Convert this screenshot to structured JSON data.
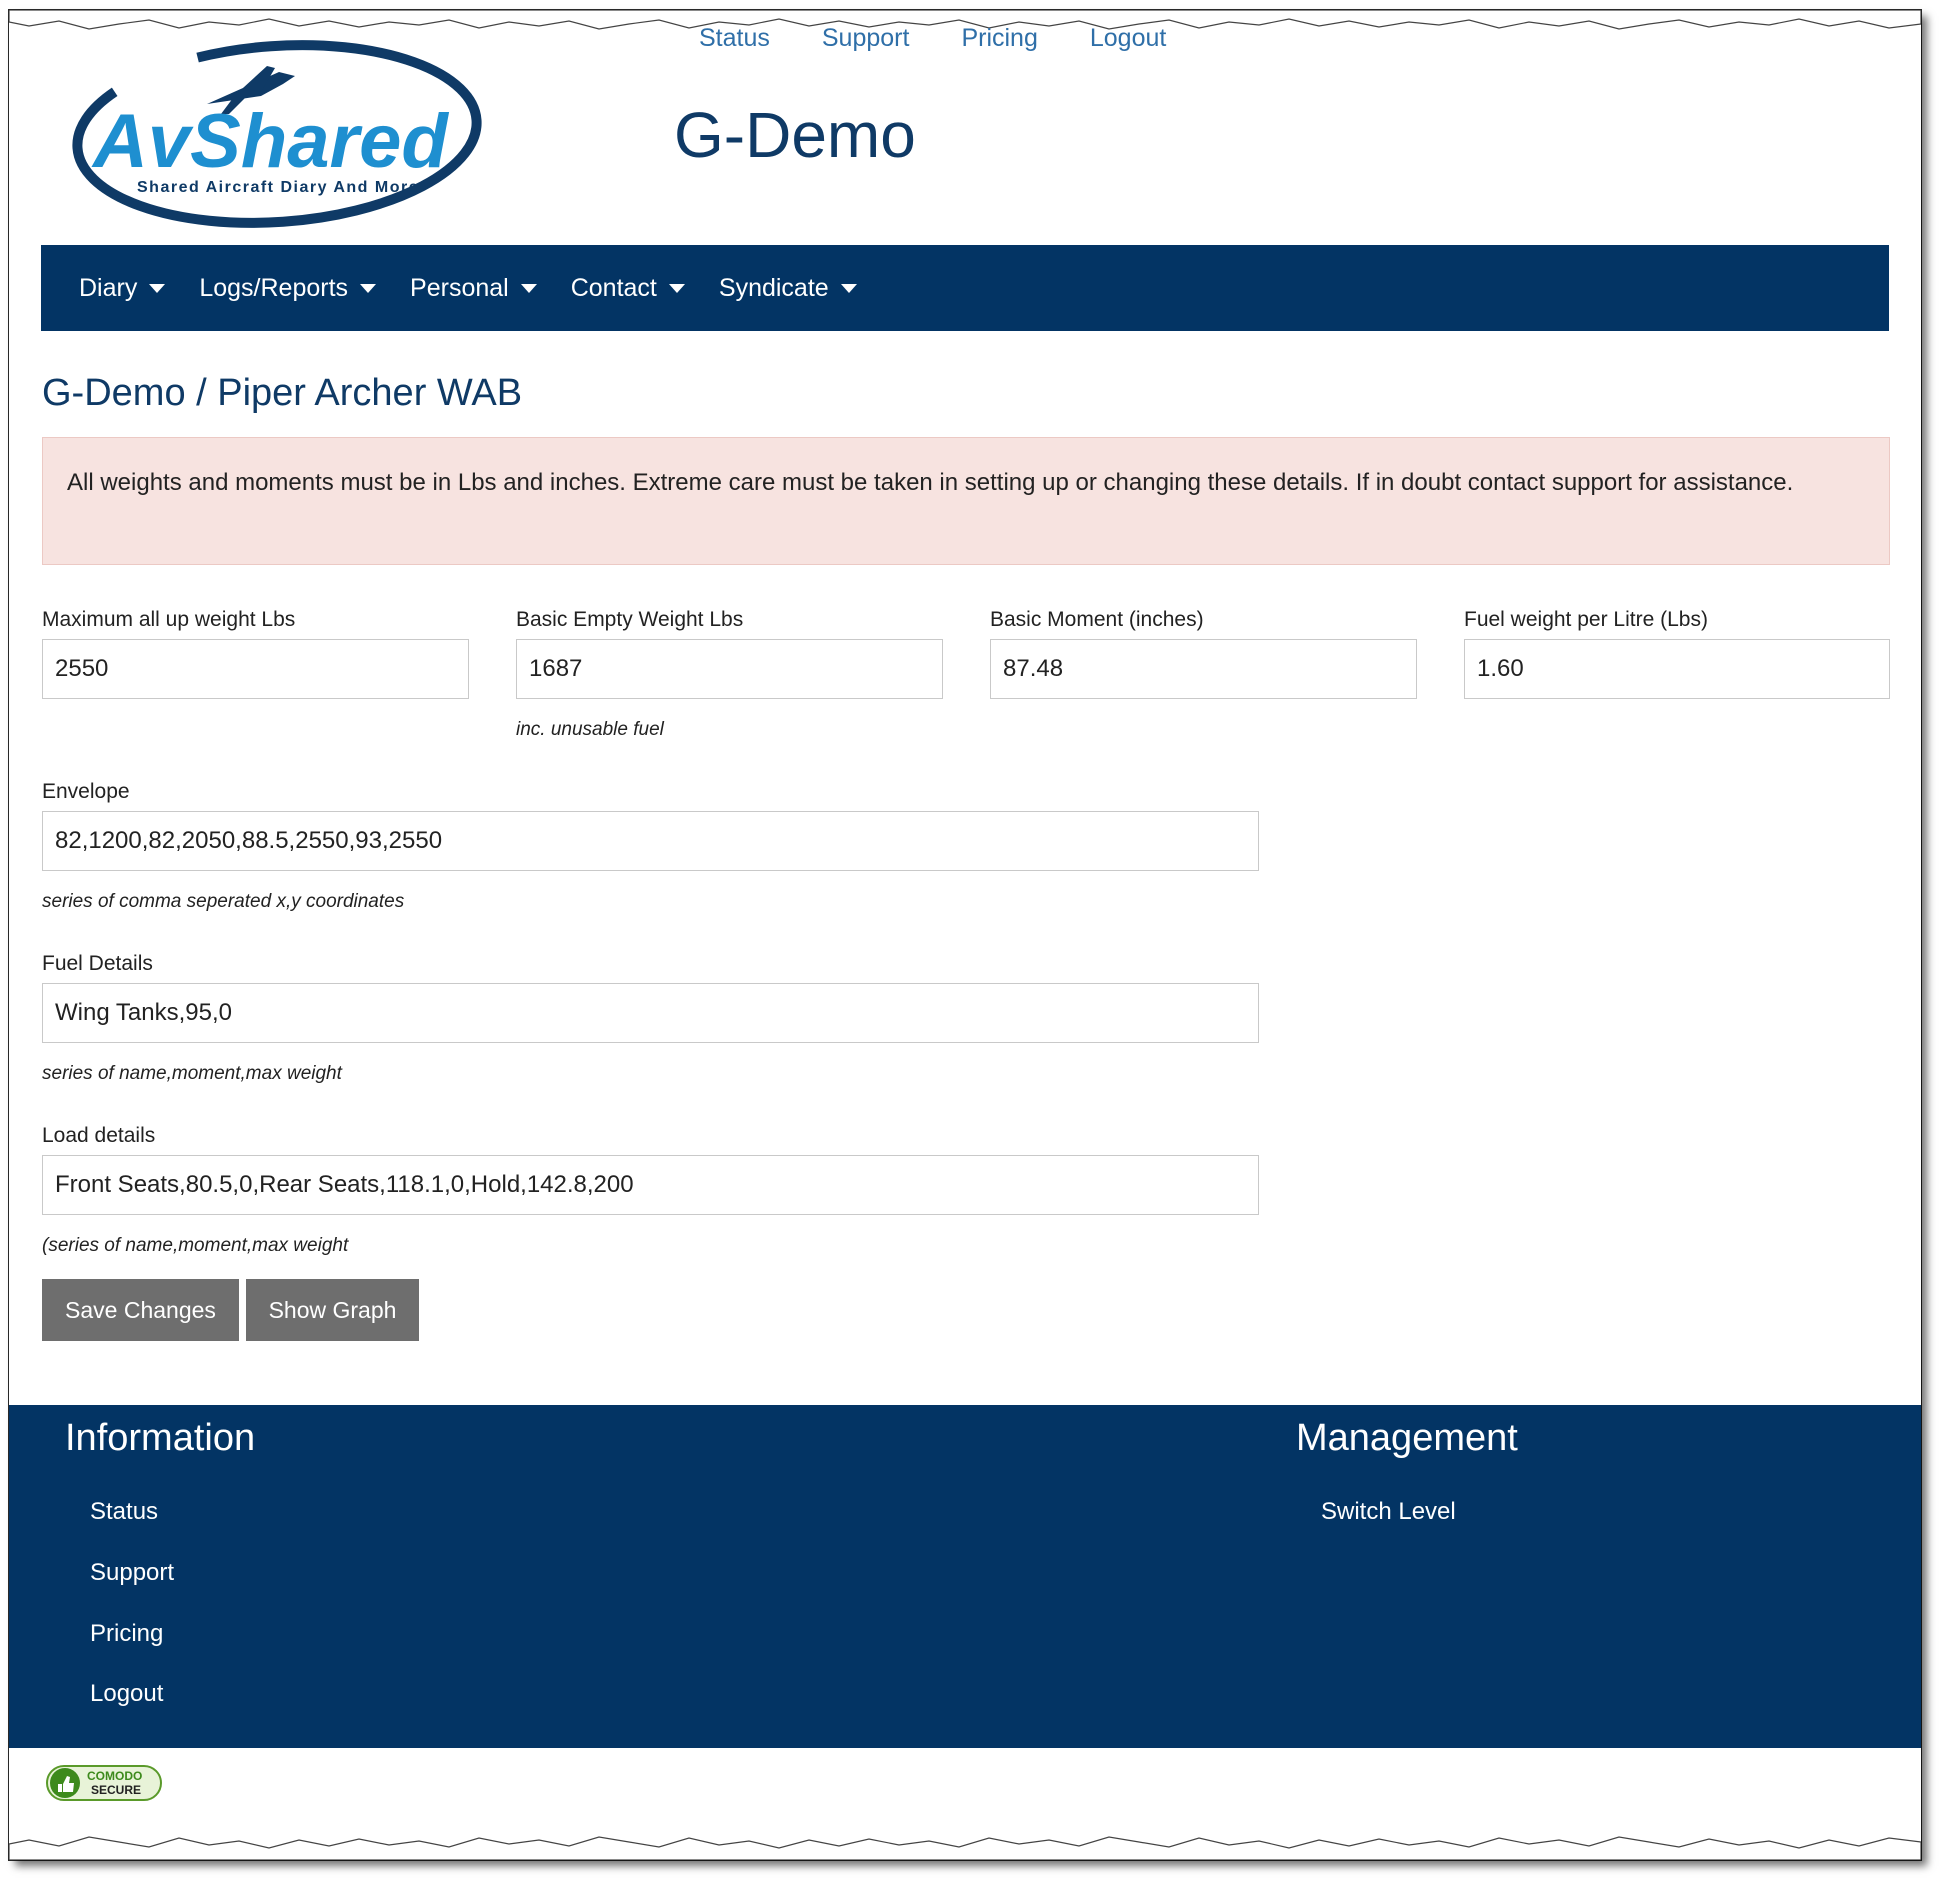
{
  "top_nav": {
    "links": [
      "Status",
      "Support",
      "Pricing",
      "Logout"
    ]
  },
  "logo": {
    "brand": "AvShared",
    "tagline": "Shared Aircraft Diary And More"
  },
  "site_title": "G-Demo",
  "main_nav": {
    "items": [
      "Diary",
      "Logs/Reports",
      "Personal",
      "Contact",
      "Syndicate"
    ]
  },
  "page": {
    "heading": "G-Demo / Piper Archer WAB",
    "alert": "All weights and moments must be in Lbs and inches. Extreme care must be taken in setting up or changing these details. If in doubt contact support for assistance."
  },
  "form": {
    "max_weight": {
      "label": "Maximum all up weight Lbs",
      "value": "2550"
    },
    "empty_weight": {
      "label": "Basic Empty Weight Lbs",
      "value": "1687",
      "help": "inc. unusable fuel"
    },
    "basic_moment": {
      "label": "Basic Moment (inches)",
      "value": "87.48"
    },
    "fuel_weight": {
      "label": "Fuel weight per Litre (Lbs)",
      "value": "1.60"
    },
    "envelope": {
      "label": "Envelope",
      "value": "82,1200,82,2050,88.5,2550,93,2550",
      "help": "series of comma seperated x,y coordinates"
    },
    "fuel_details": {
      "label": "Fuel Details",
      "value": "Wing Tanks,95,0",
      "help": "series of name,moment,max weight"
    },
    "load_details": {
      "label": "Load details",
      "value": "Front Seats,80.5,0,Rear Seats,118.1,0,Hold,142.8,200",
      "help": "(series of name,moment,max weight"
    },
    "save_label": "Save Changes",
    "graph_label": "Show Graph"
  },
  "footer": {
    "information": {
      "heading": "Information",
      "links": [
        "Status",
        "Support",
        "Pricing",
        "Logout"
      ]
    },
    "management": {
      "heading": "Management",
      "links": [
        "Switch Level"
      ]
    }
  },
  "badge": {
    "line1": "COMODO",
    "line2": "SECURE"
  },
  "colors": {
    "brand_navy": "#033464",
    "link_blue": "#2f6fa8",
    "alert_bg": "#f7e3e0",
    "button_gray": "#6e6e6e",
    "logo_cyan": "#1e8fd0"
  }
}
